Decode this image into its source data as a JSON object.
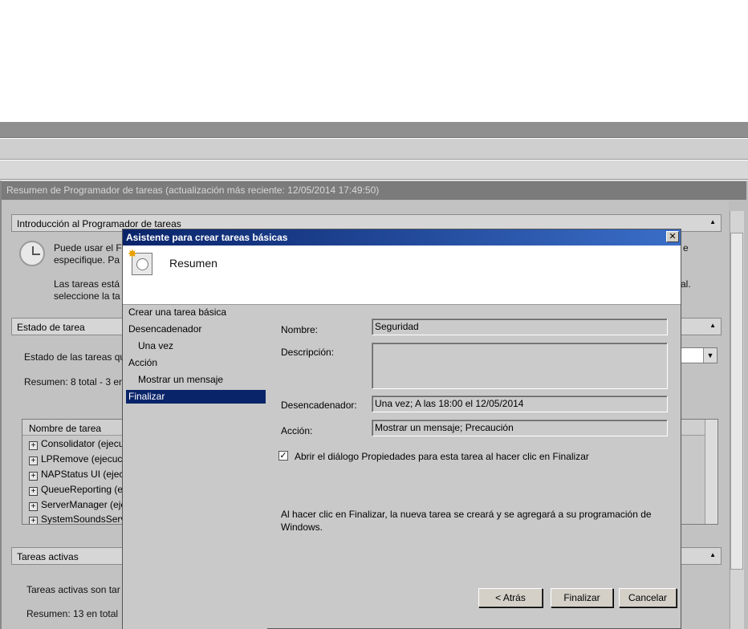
{
  "background": {
    "summary_header": "Resumen de Programador de tareas (actualización más reciente: 12/05/2014 17:49:50)",
    "intro_panel": {
      "title": "Introducción al Programador de tareas",
      "text1_line1": "Puede usar el F",
      "text1_line2": "especifique. Pa",
      "text2_line1": "Las tareas está",
      "text2_line2": "seleccione la ta",
      "right_fragment1": "e",
      "right_fragment2": "al."
    },
    "status_panel": {
      "title": "Estado de tarea",
      "status_label": "Estado de las tareas qu",
      "summary": "Resumen: 8 total - 3 en"
    },
    "task_list": {
      "column": "Nombre de tarea",
      "rows": [
        "Consolidator (ejecu",
        "LPRemove (ejecuci",
        "NAPStatus UI (ejecu",
        "QueueReporting (e",
        "ServerManager (eje",
        "SystemSoundsServ"
      ]
    },
    "active_panel": {
      "title": "Tareas activas",
      "text": "Tareas activas son tar",
      "summary": "Resumen: 13 en total"
    }
  },
  "dialog": {
    "title": "Asistente para crear tareas básicas",
    "close": "✕",
    "heading": "Resumen",
    "steps": [
      {
        "label": "Crear una tarea básica"
      },
      {
        "label": "Desencadenador"
      },
      {
        "label": "Una vez"
      },
      {
        "label": "Acción"
      },
      {
        "label": "Mostrar un mensaje"
      },
      {
        "label": "Finalizar"
      }
    ],
    "fields": {
      "name_label": "Nombre:",
      "name_value": "Seguridad",
      "description_label": "Descripción:",
      "description_value": "",
      "trigger_label": "Desencadenador:",
      "trigger_value": "Una vez; A las 18:00 el 12/05/2014",
      "action_label": "Acción:",
      "action_value": "Mostrar un mensaje; Precaución"
    },
    "checkbox_label": "Abrir el diálogo Propiedades para esta tarea al hacer clic en Finalizar",
    "checkbox_checked": true,
    "info_text_line1": "Al hacer clic en Finalizar, la nueva tarea se creará y se agregará a su programación de",
    "info_text_line2": "Windows.",
    "buttons": {
      "back": "< Atrás",
      "finish": "Finalizar",
      "cancel": "Cancelar"
    }
  },
  "colors": {
    "title_bar": "#0a246a",
    "selection": "#0a246a",
    "dialog_bg": "#c9c9c9"
  }
}
